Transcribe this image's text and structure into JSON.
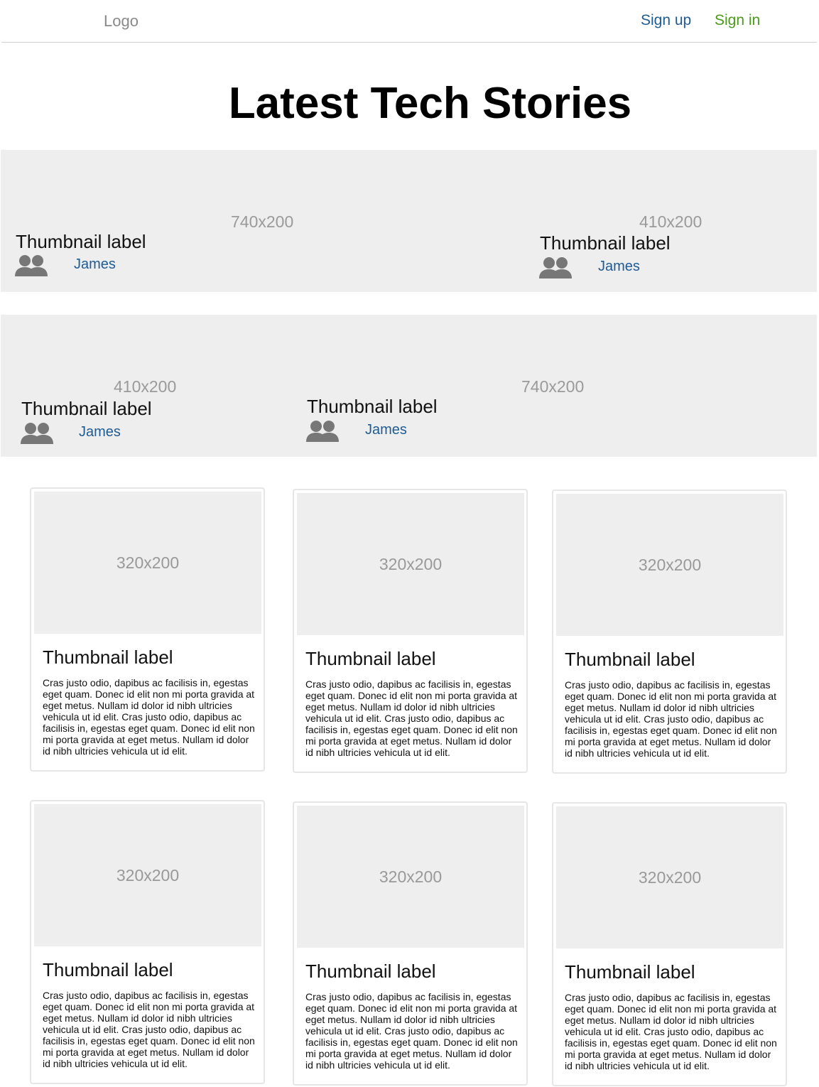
{
  "nav": {
    "logo": "Logo",
    "signup": "Sign up",
    "signin": "Sign in"
  },
  "title": "Latest Tech Stories",
  "hero_rows": [
    [
      {
        "dims": "740x200",
        "label": "Thumbnail label",
        "author": "James",
        "author_icon": "users-icon"
      },
      {
        "dims": "410x200",
        "label": "Thumbnail label",
        "author": "James",
        "author_icon": "users-icon"
      }
    ],
    [
      {
        "dims": "410x200",
        "label": "Thumbnail label",
        "author": "James",
        "author_icon": "users-icon"
      },
      {
        "dims": "740x200",
        "label": "Thumbnail label",
        "author": "James",
        "author_icon": "users-icon"
      }
    ]
  ],
  "cards": [
    {
      "dims": "320x200",
      "label": "Thumbnail label",
      "text": "Cras justo odio, dapibus ac facilisis in, egestas eget quam. Donec id elit non mi porta gravida at eget metus. Nullam id dolor id nibh ultricies vehicula ut id elit. Cras justo odio, dapibus ac facilisis in, egestas eget quam. Donec id elit non mi porta gravida at eget metus. Nullam id dolor id nibh ultricies vehicula ut id elit."
    },
    {
      "dims": "320x200",
      "label": "Thumbnail label",
      "text": "Cras justo odio, dapibus ac facilisis in, egestas eget quam. Donec id elit non mi porta gravida at eget metus. Nullam id dolor id nibh ultricies vehicula ut id elit. Cras justo odio, dapibus ac facilisis in, egestas eget quam. Donec id elit non mi porta gravida at eget metus. Nullam id dolor id nibh ultricies vehicula ut id elit."
    },
    {
      "dims": "320x200",
      "label": "Thumbnail label",
      "text": "Cras justo odio, dapibus ac facilisis in, egestas eget quam. Donec id elit non mi porta gravida at eget metus. Nullam id dolor id nibh ultricies vehicula ut id elit. Cras justo odio, dapibus ac facilisis in, egestas eget quam. Donec id elit non mi porta gravida at eget metus. Nullam id dolor id nibh ultricies vehicula ut id elit."
    },
    {
      "dims": "320x200",
      "label": "Thumbnail label",
      "text": "Cras justo odio, dapibus ac facilisis in, egestas eget quam. Donec id elit non mi porta gravida at eget metus. Nullam id dolor id nibh ultricies vehicula ut id elit. Cras justo odio, dapibus ac facilisis in, egestas eget quam. Donec id elit non mi porta gravida at eget metus. Nullam id dolor id nibh ultricies vehicula ut id elit."
    },
    {
      "dims": "320x200",
      "label": "Thumbnail label",
      "text": "Cras justo odio, dapibus ac facilisis in, egestas eget quam. Donec id elit non mi porta gravida at eget metus. Nullam id dolor id nibh ultricies vehicula ut id elit. Cras justo odio, dapibus ac facilisis in, egestas eget quam. Donec id elit non mi porta gravida at eget metus. Nullam id dolor id nibh ultricies vehicula ut id elit."
    },
    {
      "dims": "320x200",
      "label": "Thumbnail label",
      "text": "Cras justo odio, dapibus ac facilisis in, egestas eget quam. Donec id elit non mi porta gravida at eget metus. Nullam id dolor id nibh ultricies vehicula ut id elit. Cras justo odio, dapibus ac facilisis in, egestas eget quam. Donec id elit non mi porta gravida at eget metus. Nullam id dolor id nibh ultricies vehicula ut id elit."
    }
  ],
  "colors": {
    "link_blue": "#1f5b94",
    "signin_green": "#4a9a1c",
    "placeholder_bg": "#eeeeee",
    "icon_gray": "#777777"
  }
}
